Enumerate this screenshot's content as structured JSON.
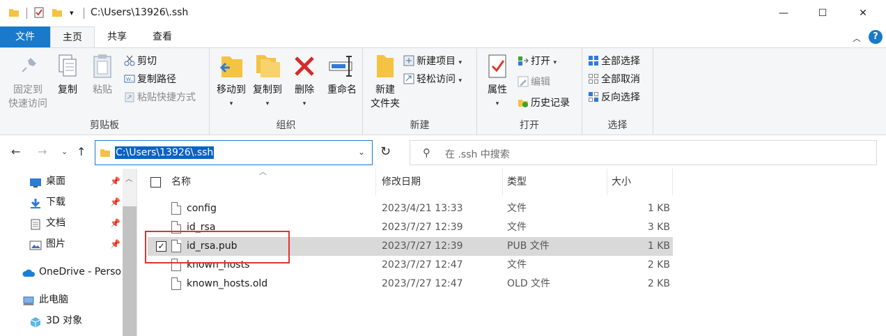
{
  "window": {
    "title": "C:\\Users\\13926\\.ssh",
    "minimize": "—",
    "maximize": "☐",
    "close": "✕"
  },
  "ribbon_tabs": {
    "file": "文件",
    "home": "主页",
    "share": "共享",
    "view": "查看"
  },
  "ribbon": {
    "clipboard": {
      "label": "剪贴板",
      "pin": "固定到\n快速访问",
      "pin_line1": "固定到",
      "pin_line2": "快速访问",
      "copy": "复制",
      "paste": "粘贴",
      "cut": "剪切",
      "copy_path": "复制路径",
      "paste_shortcut": "粘贴快捷方式"
    },
    "organize": {
      "label": "组织",
      "move_to": "移动到",
      "copy_to": "复制到",
      "delete": "删除",
      "rename": "重命名"
    },
    "new": {
      "label": "新建",
      "new_folder_line1": "新建",
      "new_folder_line2": "文件夹",
      "new_item": "新建项目",
      "easy_access": "轻松访问"
    },
    "open": {
      "label": "打开",
      "properties": "属性",
      "open": "打开",
      "edit": "编辑",
      "history": "历史记录"
    },
    "select": {
      "label": "选择",
      "select_all": "全部选择",
      "select_none": "全部取消",
      "invert": "反向选择"
    }
  },
  "address": {
    "path": "C:\\Users\\13926\\.ssh",
    "search_placeholder": "在 .ssh 中搜索"
  },
  "nav_pane": {
    "items": [
      {
        "label": "桌面",
        "pinned": true
      },
      {
        "label": "下载",
        "pinned": true
      },
      {
        "label": "文档",
        "pinned": true
      },
      {
        "label": "图片",
        "pinned": true
      },
      {
        "label": "OneDrive - Perso",
        "pinned": false
      },
      {
        "label": "此电脑",
        "pinned": false
      },
      {
        "label": "3D 对象",
        "pinned": false
      }
    ]
  },
  "columns": {
    "name": "名称",
    "date": "修改日期",
    "type": "类型",
    "size": "大小"
  },
  "files": [
    {
      "name": "config",
      "date": "2023/4/21 13:33",
      "type": "文件",
      "size": "1 KB",
      "selected": false
    },
    {
      "name": "id_rsa",
      "date": "2023/7/27 12:39",
      "type": "文件",
      "size": "3 KB",
      "selected": false
    },
    {
      "name": "id_rsa.pub",
      "date": "2023/7/27 12:39",
      "type": "PUB 文件",
      "size": "1 KB",
      "selected": true
    },
    {
      "name": "known_hosts",
      "date": "2023/7/27 12:47",
      "type": "文件",
      "size": "2 KB",
      "selected": false
    },
    {
      "name": "known_hosts.old",
      "date": "2023/7/27 12:47",
      "type": "OLD 文件",
      "size": "2 KB",
      "selected": false
    }
  ],
  "colors": {
    "accent": "#1979ca",
    "selection": "#d9d9d9",
    "highlight_box": "#e0322f",
    "folder": "#f5c342"
  }
}
